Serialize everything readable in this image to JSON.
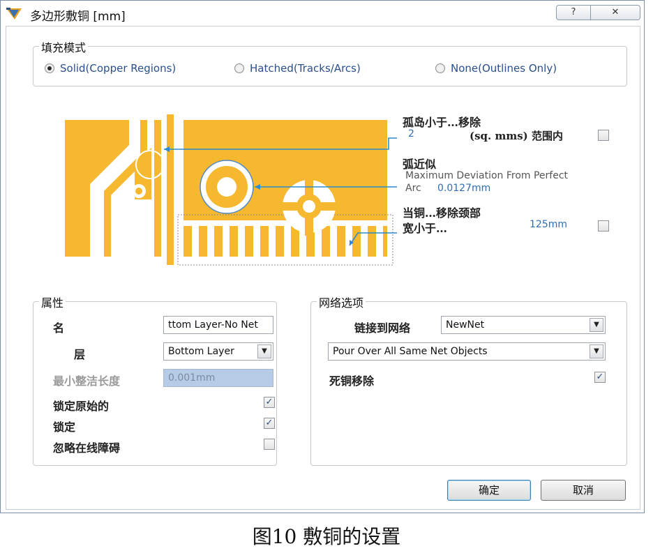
{
  "window": {
    "title": "多边形敷铜 [mm]",
    "help_icon": "?",
    "close_icon": "✕"
  },
  "fill_mode": {
    "legend": "填充模式",
    "options": [
      {
        "label": "Solid(Copper Regions)",
        "selected": true
      },
      {
        "label": "Hatched(Tracks/Arcs)",
        "selected": false
      },
      {
        "label": "None(Outlines Only)",
        "selected": false
      }
    ]
  },
  "preview": {
    "island_title": "孤岛小于…移除",
    "island_value": "2",
    "island_unit": "(sq. mms) 范围内",
    "island_checked": false,
    "arc_title": "弧近似",
    "arc_desc": "Maximum Deviation From Perfect",
    "arc_label": "Arc",
    "arc_value": "0.0127mm",
    "neck_title": "当铜…移除颈部",
    "neck_label": "宽小于…",
    "neck_value": "125mm",
    "neck_checked": false,
    "copper_color": "#f5b82e"
  },
  "properties": {
    "legend": "属性",
    "name_label": "名",
    "name_value": "ttom Layer-No Net",
    "layer_label": "层",
    "layer_value": "Bottom Layer",
    "min_length_label": "最小整洁长度",
    "min_length_value": "0.001mm",
    "lock_primitives_label": "锁定原始的",
    "lock_primitives_checked": true,
    "locked_label": "锁定",
    "locked_checked": true,
    "ignore_obstacles_label": "忽略在线障碍",
    "ignore_obstacles_checked": false
  },
  "net_options": {
    "legend": "网络选项",
    "connect_label": "链接到网络",
    "connect_value": "NewNet",
    "pour_value": "Pour Over All Same Net Objects",
    "remove_dead_label": "死铜移除",
    "remove_dead_checked": true
  },
  "buttons": {
    "ok": "确定",
    "cancel": "取消"
  },
  "caption": "图10  敷铜的设置"
}
